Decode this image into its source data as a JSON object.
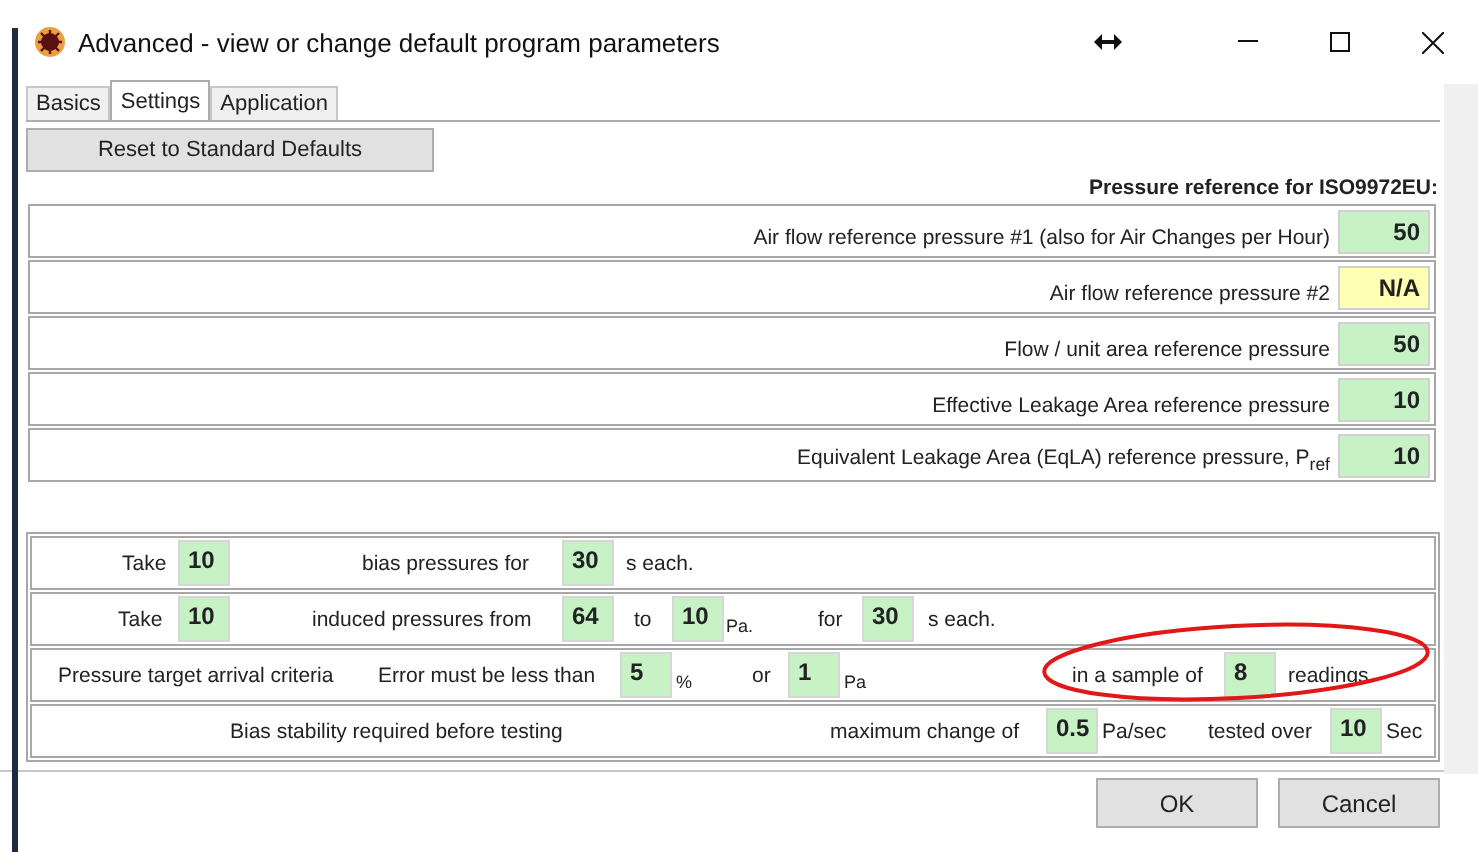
{
  "window": {
    "title": "Advanced - view or change default program parameters"
  },
  "tabs": [
    {
      "label": "Basics",
      "selected": false
    },
    {
      "label": "Settings",
      "selected": true
    },
    {
      "label": "Application",
      "selected": false
    }
  ],
  "reset_button": "Reset to Standard Defaults",
  "reference_heading": "Pressure reference for ISO9972EU:",
  "reference_rows": [
    {
      "label": "Air flow reference pressure #1 (also for Air Changes per Hour)",
      "value": "50",
      "disabled": false
    },
    {
      "label": "Air flow reference pressure #2",
      "value": "N/A",
      "disabled": true
    },
    {
      "label": "Flow / unit area reference pressure",
      "value": "50",
      "disabled": false
    },
    {
      "label": "Effective Leakage Area reference pressure",
      "value": "10",
      "disabled": false
    },
    {
      "label": "Equivalent Leakage Area (EqLA) reference pressure, P$_{ref}$",
      "value": "10",
      "disabled": false
    }
  ],
  "test_rows": [
    {
      "segments": [
        {
          "kind": "text",
          "text": "Take"
        },
        {
          "kind": "field",
          "text": "10"
        },
        {
          "kind": "text",
          "text": "bias pressures for"
        },
        {
          "kind": "field",
          "text": "30"
        },
        {
          "kind": "text",
          "text": "s each."
        }
      ]
    },
    {
      "segments": [
        {
          "kind": "text",
          "text": "Take"
        },
        {
          "kind": "field",
          "text": "10"
        },
        {
          "kind": "text",
          "text": "induced pressures from"
        },
        {
          "kind": "field",
          "text": "64"
        },
        {
          "kind": "text",
          "text": "to"
        },
        {
          "kind": "field",
          "text": "10"
        },
        {
          "kind": "unit",
          "text": "Pa."
        },
        {
          "kind": "text",
          "text": "for"
        },
        {
          "kind": "field",
          "text": "30"
        },
        {
          "kind": "text",
          "text": "s each."
        }
      ]
    },
    {
      "segments": [
        {
          "kind": "text",
          "text": "Pressure target arrival criteria"
        },
        {
          "kind": "text",
          "text": "Error must be less than"
        },
        {
          "kind": "field",
          "text": "5"
        },
        {
          "kind": "unit",
          "text": "%"
        },
        {
          "kind": "text",
          "text": "or"
        },
        {
          "kind": "field",
          "text": "1"
        },
        {
          "kind": "unit",
          "text": "Pa"
        },
        {
          "kind": "text",
          "text": "in a sample of"
        },
        {
          "kind": "field",
          "text": "8"
        },
        {
          "kind": "text",
          "text": "readings"
        }
      ]
    },
    {
      "segments": [
        {
          "kind": "text",
          "text": "Bias stability required before testing"
        },
        {
          "kind": "text",
          "text": "maximum change of"
        },
        {
          "kind": "field",
          "text": "0.5"
        },
        {
          "kind": "text",
          "text": "Pa/sec"
        },
        {
          "kind": "text",
          "text": "tested over"
        },
        {
          "kind": "field",
          "text": "10"
        },
        {
          "kind": "text",
          "text": "Sec"
        }
      ]
    }
  ],
  "buttons": [
    "OK",
    "Cancel"
  ]
}
